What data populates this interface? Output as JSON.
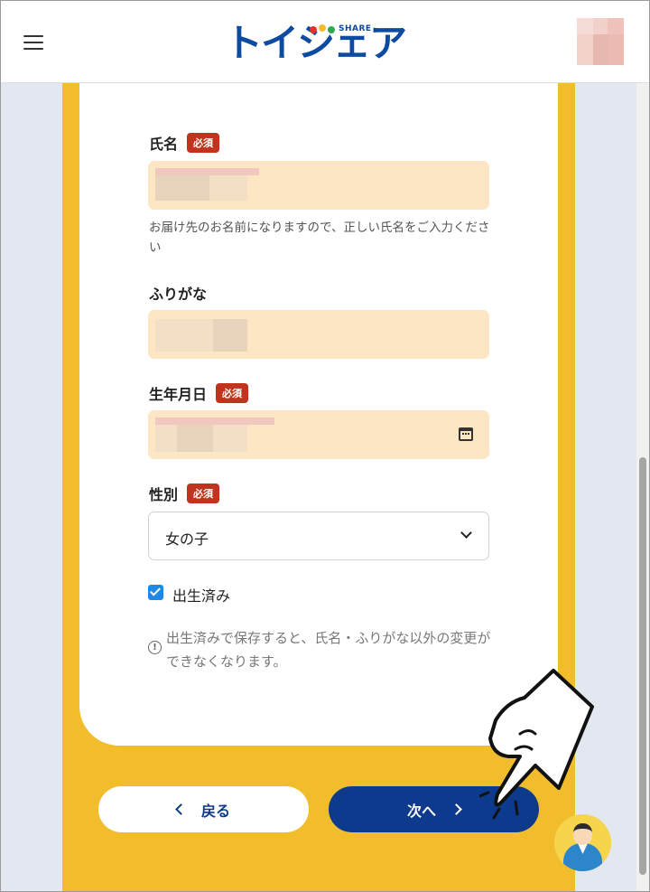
{
  "header": {
    "logo_text": "トイシェア",
    "logo_sub": "SHARE",
    "menu_icon": "hamburger-menu-icon",
    "avatar_icon": "user-avatar"
  },
  "form": {
    "name": {
      "label": "氏名",
      "required_badge": "必須",
      "helper": "お届け先のお名前になりますので、正しい氏名をご入力ください"
    },
    "furigana": {
      "label": "ふりがな"
    },
    "birthdate": {
      "label": "生年月日",
      "required_badge": "必須",
      "icon": "calendar-icon"
    },
    "gender": {
      "label": "性別",
      "required_badge": "必須",
      "selected": "女の子"
    },
    "born": {
      "label": "出生済み",
      "checked": true
    },
    "notice": "出生済みで保存すると、氏名・ふりがな以外の変更ができなくなります。"
  },
  "buttons": {
    "back": "戻る",
    "next": "次へ"
  },
  "colors": {
    "brand_blue": "#0d3a8c",
    "accent_yellow": "#f2bd2d",
    "field_bg": "#fde6c4",
    "required_red": "#c0341d",
    "checkbox_blue": "#1e88e5"
  }
}
